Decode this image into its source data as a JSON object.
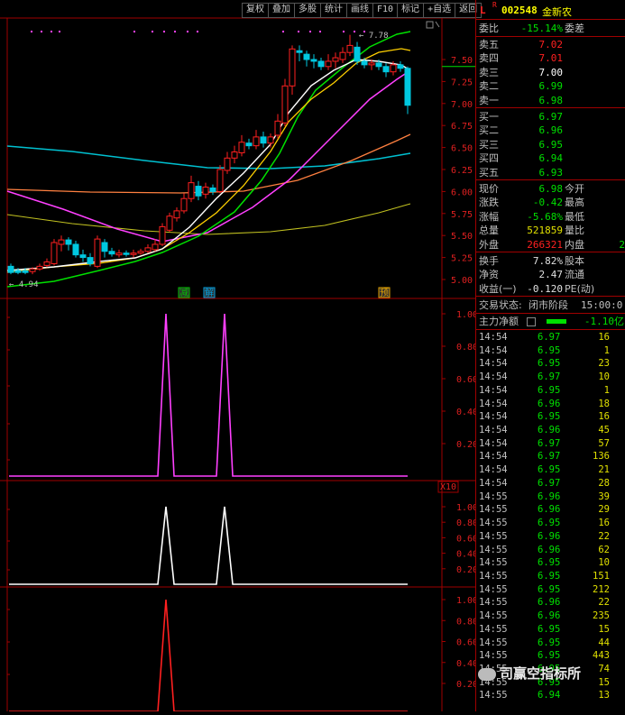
{
  "toolbar": [
    "复权",
    "叠加",
    "多股",
    "统计",
    "画线",
    "F10",
    "标记",
    "+自选",
    "返回"
  ],
  "chart": {
    "price_axis": [
      "7.50",
      "7.25",
      "7.00",
      "6.75",
      "6.50",
      "6.25",
      "6.00",
      "5.75",
      "5.50",
      "5.25",
      "5.00"
    ],
    "high_label": "7.78",
    "low_label": "4.94",
    "markers": [
      "减",
      "解",
      "预"
    ],
    "indicator_axis": [
      "1.00",
      "0.80",
      "0.60",
      "0.40",
      "0.20"
    ],
    "x10_label": "X10",
    "colors": {
      "up": "#ff2020",
      "down": "#00c8e0",
      "ma5": "#ffffff",
      "ma10": "#ffd000",
      "ma20": "#ff40ff",
      "ma30": "#00e000",
      "ma60": "#ff8040",
      "ma120": "#00c0d0",
      "ma250": "#c0c020",
      "ind1": "#ff40ff",
      "ind2": "#ffffff",
      "ind3": "#ff2020"
    }
  },
  "chart_data": [
    {
      "type": "line",
      "title": "",
      "series": [
        {
          "name": "",
          "values": [
            0,
            0,
            0,
            0,
            0,
            1,
            0,
            0,
            0,
            0,
            1,
            0,
            0,
            0,
            0,
            0,
            0,
            0,
            0,
            0
          ]
        }
      ],
      "ylim": [
        0,
        1
      ]
    },
    {
      "type": "line",
      "title": "",
      "series": [
        {
          "name": "",
          "values": [
            0,
            0,
            0,
            0,
            0,
            1,
            0,
            0,
            0,
            0,
            1,
            0,
            0,
            0,
            0,
            0,
            0,
            0,
            0,
            0
          ]
        }
      ],
      "ylim": [
        0,
        1
      ]
    },
    {
      "type": "line",
      "title": "",
      "series": [
        {
          "name": "",
          "values": [
            0,
            0,
            0,
            0,
            0,
            1,
            0,
            0,
            0,
            0,
            0,
            0,
            0,
            0,
            0,
            0,
            0,
            0,
            0,
            0
          ]
        }
      ],
      "ylim": [
        0,
        1
      ]
    }
  ],
  "stock": {
    "flag1": "L",
    "flag2": "R",
    "code": "002548",
    "name": "金新农"
  },
  "quote": {
    "weibi_label": "委比",
    "weibi": "-15.14%",
    "weicha_label": "委差",
    "asks": [
      {
        "label": "卖五",
        "price": "7.02"
      },
      {
        "label": "卖四",
        "price": "7.01"
      },
      {
        "label": "卖三",
        "price": "7.00"
      },
      {
        "label": "卖二",
        "price": "6.99"
      },
      {
        "label": "卖一",
        "price": "6.98"
      }
    ],
    "bids": [
      {
        "label": "买一",
        "price": "6.97"
      },
      {
        "label": "买二",
        "price": "6.96"
      },
      {
        "label": "买三",
        "price": "6.95"
      },
      {
        "label": "买四",
        "price": "6.94"
      },
      {
        "label": "买五",
        "price": "6.93"
      }
    ],
    "stats": [
      {
        "l1": "现价",
        "v1": "6.98",
        "l2": "今开",
        "c": "#00e000"
      },
      {
        "l1": "涨跌",
        "v1": "-0.42",
        "l2": "最高",
        "c": "#00e000"
      },
      {
        "l1": "涨幅",
        "v1": "-5.68%",
        "l2": "最低",
        "c": "#00e000"
      },
      {
        "l1": "总量",
        "v1": "521859",
        "l2": "量比",
        "c": "#e0e000"
      },
      {
        "l1": "外盘",
        "v1": "266321",
        "l2": "内盘",
        "c": "#ff2020",
        "extra": "2"
      }
    ],
    "stats2": [
      {
        "l1": "换手",
        "v1": "7.82%",
        "l2": "股本",
        "c": "#e0e0e0"
      },
      {
        "l1": "净资",
        "v1": "2.47",
        "l2": "流通",
        "c": "#e0e0e0"
      },
      {
        "l1": "收益(一)",
        "v1": "-0.120",
        "l2": "PE(动)",
        "c": "#e0e0e0"
      }
    ],
    "trade_state_label": "交易状态:",
    "trade_state": "闭市阶段",
    "trade_time": "15:00:0",
    "main_flow_label": "主力净额",
    "main_flow": "-1.10亿"
  },
  "ticks": [
    {
      "t": "14:54",
      "p": "6.97",
      "v": "16",
      "c": "#00e000"
    },
    {
      "t": "14:54",
      "p": "6.95",
      "v": "1",
      "c": "#00e000"
    },
    {
      "t": "14:54",
      "p": "6.95",
      "v": "23",
      "c": "#00e000"
    },
    {
      "t": "14:54",
      "p": "6.97",
      "v": "10",
      "c": "#00e000"
    },
    {
      "t": "14:54",
      "p": "6.95",
      "v": "1",
      "c": "#00e000"
    },
    {
      "t": "14:54",
      "p": "6.96",
      "v": "18",
      "c": "#00e000"
    },
    {
      "t": "14:54",
      "p": "6.95",
      "v": "16",
      "c": "#00e000"
    },
    {
      "t": "14:54",
      "p": "6.96",
      "v": "45",
      "c": "#00e000"
    },
    {
      "t": "14:54",
      "p": "6.97",
      "v": "57",
      "c": "#00e000"
    },
    {
      "t": "14:54",
      "p": "6.97",
      "v": "136",
      "c": "#00e000"
    },
    {
      "t": "14:54",
      "p": "6.95",
      "v": "21",
      "c": "#00e000"
    },
    {
      "t": "14:54",
      "p": "6.97",
      "v": "28",
      "c": "#00e000"
    },
    {
      "t": "14:55",
      "p": "6.96",
      "v": "39",
      "c": "#00e000"
    },
    {
      "t": "14:55",
      "p": "6.96",
      "v": "29",
      "c": "#00e000"
    },
    {
      "t": "14:55",
      "p": "6.95",
      "v": "16",
      "c": "#00e000"
    },
    {
      "t": "14:55",
      "p": "6.96",
      "v": "22",
      "c": "#00e000"
    },
    {
      "t": "14:55",
      "p": "6.96",
      "v": "62",
      "c": "#00e000"
    },
    {
      "t": "14:55",
      "p": "6.95",
      "v": "10",
      "c": "#00e000"
    },
    {
      "t": "14:55",
      "p": "6.95",
      "v": "151",
      "c": "#00e000"
    },
    {
      "t": "14:55",
      "p": "6.95",
      "v": "212",
      "c": "#00e000"
    },
    {
      "t": "14:55",
      "p": "6.96",
      "v": "22",
      "c": "#00e000"
    },
    {
      "t": "14:55",
      "p": "6.96",
      "v": "235",
      "c": "#00e000"
    },
    {
      "t": "14:55",
      "p": "6.95",
      "v": "15",
      "c": "#00e000"
    },
    {
      "t": "14:55",
      "p": "6.95",
      "v": "44",
      "c": "#00e000"
    },
    {
      "t": "14:55",
      "p": "6.95",
      "v": "443",
      "c": "#00e000"
    },
    {
      "t": "14:55",
      "p": "6.95",
      "v": "74",
      "c": "#00e000"
    },
    {
      "t": "14:55",
      "p": "6.95",
      "v": "15",
      "c": "#00e000"
    },
    {
      "t": "14:55",
      "p": "6.94",
      "v": "13",
      "c": "#00e000"
    }
  ],
  "watermark": "司赢空指标所"
}
